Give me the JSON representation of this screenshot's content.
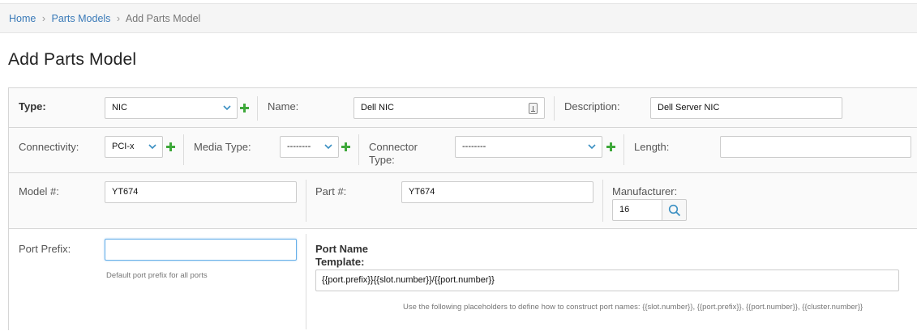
{
  "breadcrumb": {
    "home": "Home",
    "separator": "›",
    "parts_models": "Parts Models",
    "current": "Add Parts Model"
  },
  "page_title": "Add Parts Model",
  "form": {
    "type": {
      "label": "Type:",
      "value": "NIC"
    },
    "name": {
      "label": "Name:",
      "value": "Dell NIC"
    },
    "description": {
      "label": "Description:",
      "value": "Dell Server NIC"
    },
    "connectivity": {
      "label": "Connectivity:",
      "value": "PCI-x"
    },
    "media_type": {
      "label": "Media Type:",
      "value": "--------"
    },
    "connector_type": {
      "label_line1": "Connector",
      "label_line2": "Type:",
      "value": "--------"
    },
    "length": {
      "label": "Length:",
      "value": ""
    },
    "model_number": {
      "label": "Model #:",
      "value": "YT674"
    },
    "part_number": {
      "label": "Part #:",
      "value": "YT674"
    },
    "manufacturer": {
      "label": "Manufacturer:",
      "value": "16"
    },
    "port_prefix": {
      "label": "Port Prefix:",
      "value": "",
      "help": "Default port prefix for all ports"
    },
    "port_name_template": {
      "label_line1": "Port Name",
      "label_line2": "Template:",
      "value": "{{port.prefix}}{{slot.number}}/{{port.number}}",
      "help": "Use the following placeholders to define how to construct port names: {{slot.number}}, {{port.prefix}}, {{port.number}}, {{cluster.number}}"
    }
  },
  "icons": {
    "add": "plus-icon",
    "dropdown": "chevron-down-icon",
    "search": "search-icon",
    "keyboard": "input-helper-icon"
  },
  "colors": {
    "link": "#3a7ab8",
    "add_icon": "#3ea83a",
    "chevron": "#3a8fc2",
    "focus_border": "#66afe9"
  }
}
